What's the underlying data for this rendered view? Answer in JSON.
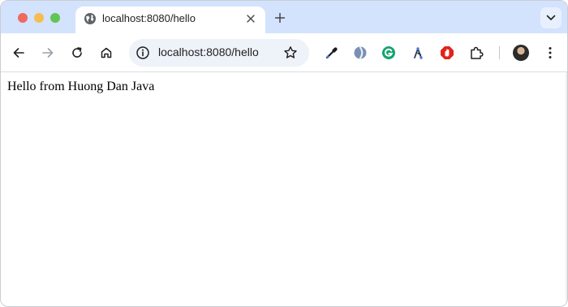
{
  "tab": {
    "title": "localhost:8080/hello"
  },
  "omnibox": {
    "url": "localhost:8080/hello"
  },
  "page": {
    "text": "Hello from Huong Dan Java"
  },
  "icons": {
    "tab_favicon": "globe-icon",
    "extensions": [
      "eyedropper-icon",
      "cloud-extension-icon",
      "grammarly-icon",
      "git-branch-icon",
      "stop-sign-icon",
      "puzzle-icon"
    ]
  },
  "colors": {
    "tabstrip_bg": "#d3e3fd",
    "omnibox_bg": "#eef2f9",
    "traffic_red": "#ee6a5f",
    "traffic_yellow": "#f5bd4f",
    "traffic_green": "#61c454"
  }
}
